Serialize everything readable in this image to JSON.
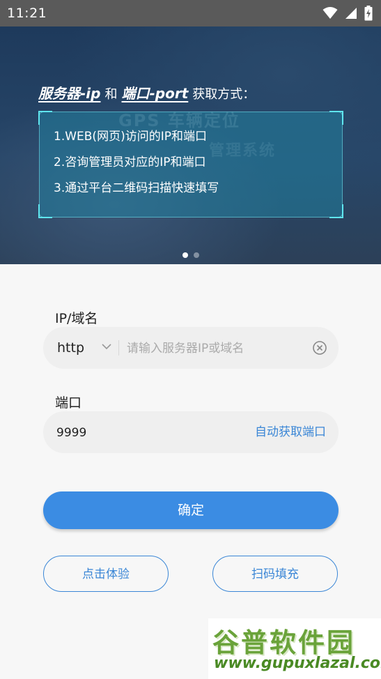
{
  "status_bar": {
    "time": "11:21"
  },
  "banner": {
    "title_ip": "服务器-ip",
    "title_and": "和",
    "title_port": "端口-port",
    "title_suffix": "获取方式：",
    "ghost_line1": "GPS 车辆定位",
    "ghost_line2": "管理系统",
    "items": [
      "1.WEB(网页)访问的IP和端口",
      "2.咨询管理员对应的IP和端口",
      "3.通过平台二维码扫描快速填写"
    ],
    "page_indicator": {
      "count": 2,
      "active": 1
    }
  },
  "form": {
    "ip_label": "IP/域名",
    "protocol": "http",
    "ip_placeholder": "请输入服务器IP或域名",
    "ip_value": "",
    "port_label": "端口",
    "port_value": "9999",
    "auto_port_link": "自动获取端口",
    "confirm_label": "确定",
    "try_label": "点击体验",
    "scan_label": "扫码填充"
  },
  "watermark": {
    "title": "谷普软件园",
    "url": "www.gupuxlazal.com"
  },
  "colors": {
    "accent": "#3b8ce3",
    "status_bar": "#5a5a5a",
    "banner_bg": "#1e3a5c",
    "watermark_green": "#6aa33a"
  }
}
